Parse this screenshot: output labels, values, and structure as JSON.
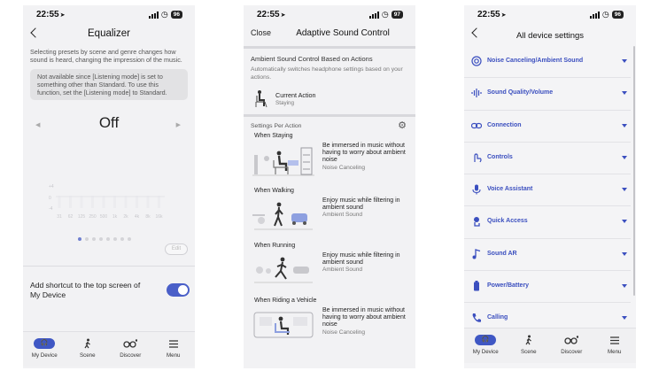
{
  "statusbar": [
    {
      "time": "22:55",
      "battery": "96"
    },
    {
      "time": "22:55",
      "battery": "97"
    },
    {
      "time": "22:55",
      "battery": "96"
    }
  ],
  "equalizer": {
    "title": "Equalizer",
    "description": "Selecting presets by scene and genre changes how sound is heard, changing the impression of the music.",
    "notice": "Not available since [Listening mode] is set to something other than Standard. To use this function, set the [Listening mode] to Standard.",
    "preset_value": "Off",
    "y_labels": [
      "+4",
      "0",
      "-4"
    ],
    "bands": [
      "31",
      "62",
      "125",
      "250",
      "500",
      "1k",
      "2k",
      "4k",
      "8k",
      "16k"
    ],
    "edit_label": "Edit",
    "shortcut_label": "Add shortcut to the top screen of My Device",
    "shortcut_on": true,
    "page_dots": 8,
    "active_dot": 1
  },
  "tabs": [
    {
      "label": "My Device",
      "icon": "headphones-icon"
    },
    {
      "label": "Scene",
      "icon": "walking-person-icon"
    },
    {
      "label": "Discover",
      "icon": "binoculars-icon"
    },
    {
      "label": "Menu",
      "icon": "hamburger-menu-icon"
    }
  ],
  "adaptive": {
    "close_label": "Close",
    "title": "Adaptive Sound Control",
    "header": "Ambient Sound Control Based on Actions",
    "subtext": "Automatically switches headphone settings based on your actions.",
    "current_action_label": "Current Action",
    "current_action_value": "Staying",
    "settings_header": "Settings Per Action",
    "actions": [
      {
        "name": "When Staying",
        "text": "Be immersed in music without having to worry about ambient noise",
        "mode": "Noise Canceling"
      },
      {
        "name": "When Walking",
        "text": "Enjoy music while filtering in ambient sound",
        "mode": "Ambient Sound"
      },
      {
        "name": "When Running",
        "text": "Enjoy music while filtering in ambient sound",
        "mode": "Ambient Sound"
      },
      {
        "name": "When Riding a Vehicle",
        "text": "Be immersed in music without having to worry about ambient noise",
        "mode": "Noise Canceling"
      }
    ]
  },
  "all_settings": {
    "title": "All device settings",
    "accent": "#3b4fbf",
    "items": [
      {
        "label": "Noise Canceling/Ambient Sound",
        "icon": "noise-canceling-icon"
      },
      {
        "label": "Sound Quality/Volume",
        "icon": "sound-wave-icon"
      },
      {
        "label": "Connection",
        "icon": "link-icon"
      },
      {
        "label": "Controls",
        "icon": "touch-controls-icon"
      },
      {
        "label": "Voice Assistant",
        "icon": "microphone-icon"
      },
      {
        "label": "Quick Access",
        "icon": "quick-access-icon"
      },
      {
        "label": "Sound AR",
        "icon": "music-note-icon"
      },
      {
        "label": "Power/Battery",
        "icon": "battery-icon"
      },
      {
        "label": "Calling",
        "icon": "phone-icon"
      }
    ]
  }
}
